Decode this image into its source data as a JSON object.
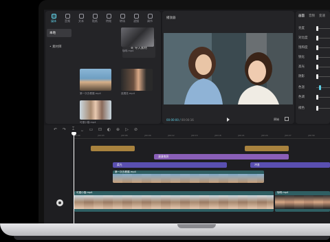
{
  "media": {
    "tools": [
      {
        "label": "媒体",
        "icon": "media-icon",
        "active": true
      },
      {
        "label": "音频",
        "icon": "audio-icon"
      },
      {
        "label": "文本",
        "icon": "text-icon"
      },
      {
        "label": "贴纸",
        "icon": "sticker-icon"
      },
      {
        "label": "特效",
        "icon": "effects-icon"
      },
      {
        "label": "转场",
        "icon": "transition-icon"
      },
      {
        "label": "滤镜",
        "icon": "filter-icon"
      },
      {
        "label": "调节",
        "icon": "adjust-icon"
      }
    ],
    "sidebar": [
      {
        "label": "本地",
        "active": true
      },
      {
        "label": "• 素材库",
        "active": false
      }
    ],
    "import_label": "导入素材",
    "captions": [
      "咖啡.mp4",
      "第一次去看展.mp4",
      "逛展览.mp4",
      "可爱小猫.mp4"
    ]
  },
  "player": {
    "title": "播放器",
    "time_current": "00:00:00",
    "time_total": "00:00:16",
    "ratio_label": "原始"
  },
  "props": {
    "tabs": [
      "画面",
      "音频",
      "变速"
    ],
    "rows": [
      "亮度",
      "对比度",
      "饱和度",
      "锐化",
      "高光",
      "阴影",
      "色温",
      "色调",
      "褪色"
    ]
  },
  "timeline": {
    "tools": [
      "↶",
      "↷",
      "⌶",
      "⎵",
      "▭",
      "⊡",
      "◐",
      "⊕",
      "▷",
      "⊘"
    ],
    "ruler": [
      "00:00",
      "|00:03",
      "|00:06",
      "|00:09",
      "|00:12",
      "|00:15",
      "|00:18",
      "|00:21",
      "|00:24",
      "|00:27",
      "|00:30"
    ],
    "clips": {
      "sticker": "",
      "text": "漫漫南屏",
      "effect_a": "柔光",
      "effect_b": "冲浪",
      "overlay": "第一次去看展.mp4",
      "main_a": "可爱小猫.mp4",
      "main_b": "咖啡.mp4"
    }
  },
  "colors": {
    "accent": "#5fd0e6",
    "sticker_clip": "#a8823e",
    "text_clip": "#8a5fb8",
    "effect_clip": "#5a4fb0",
    "video_track": "#2f5f63"
  }
}
